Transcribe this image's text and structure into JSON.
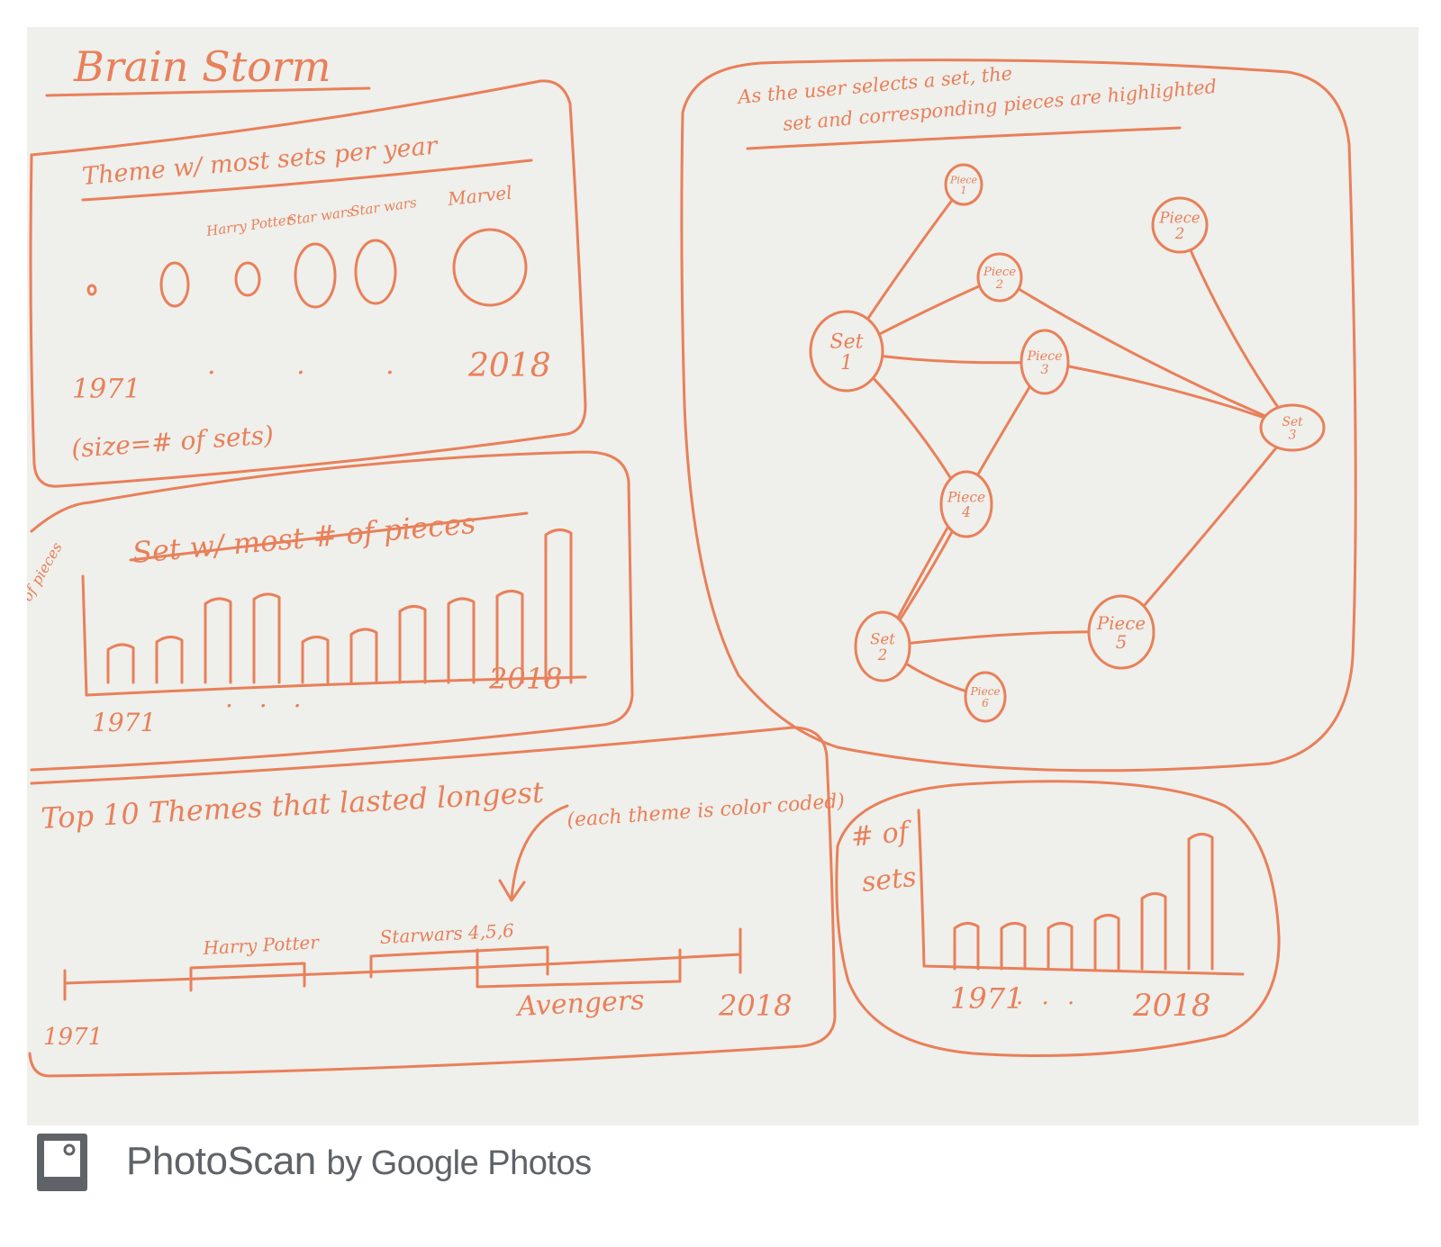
{
  "colors": {
    "ink": "#e8805a",
    "ink_dark": "#d9663e",
    "board": "#efefeb",
    "footer_text": "#5f6368"
  },
  "board": {
    "title": "Brain Storm"
  },
  "panel_themes": {
    "title": "Theme w/ most sets per year",
    "circle_labels": [
      "Harry Potter",
      "Star wars",
      "Star wars",
      "Marvel"
    ],
    "start_year": "1971",
    "end_year": "2018",
    "ellipsis": ". . .",
    "note": "(size=# of sets)"
  },
  "panel_pieces": {
    "title": "Set w/ most # of pieces",
    "ylabel": "# of pieces",
    "start_year": "1971",
    "end_year": "2018",
    "ellipsis": ". . .",
    "bar_heights_relative": [
      0.25,
      0.3,
      0.55,
      0.58,
      0.3,
      0.35,
      0.5,
      0.55,
      0.6,
      1.0
    ]
  },
  "panel_timeline": {
    "title": "Top 10 Themes that lasted longest",
    "note": "(each theme is color coded)",
    "start_year": "1971",
    "end_year": "2018",
    "spans": [
      {
        "label": "Harry Potter"
      },
      {
        "label": "Starwars 4,5,6"
      },
      {
        "label": "Avengers"
      }
    ]
  },
  "panel_network": {
    "caption": "As the user selects a set, the set and corresponding pieces are highlighted",
    "nodes": [
      {
        "id": "set1",
        "label": "Set 1"
      },
      {
        "id": "set2",
        "label": "Set 2"
      },
      {
        "id": "set3",
        "label": "Set 3"
      },
      {
        "id": "p1",
        "label": "Piece 1"
      },
      {
        "id": "p2a",
        "label": "Piece 2"
      },
      {
        "id": "p2b",
        "label": "Piece 2"
      },
      {
        "id": "p3",
        "label": "Piece 3"
      },
      {
        "id": "p4",
        "label": "Piece 4"
      },
      {
        "id": "p5",
        "label": "Piece 5"
      },
      {
        "id": "p6",
        "label": "Piece 6"
      }
    ]
  },
  "panel_sets": {
    "ylabel": "# of sets",
    "start_year": "1971",
    "ellipsis": ". . .",
    "end_year": "2018",
    "bar_heights_relative": [
      0.34,
      0.34,
      0.34,
      0.4,
      0.56,
      1.0
    ]
  },
  "footer": {
    "brand": "PhotoScan",
    "sub": "by Google Photos",
    "icon": "photoscan-icon"
  }
}
